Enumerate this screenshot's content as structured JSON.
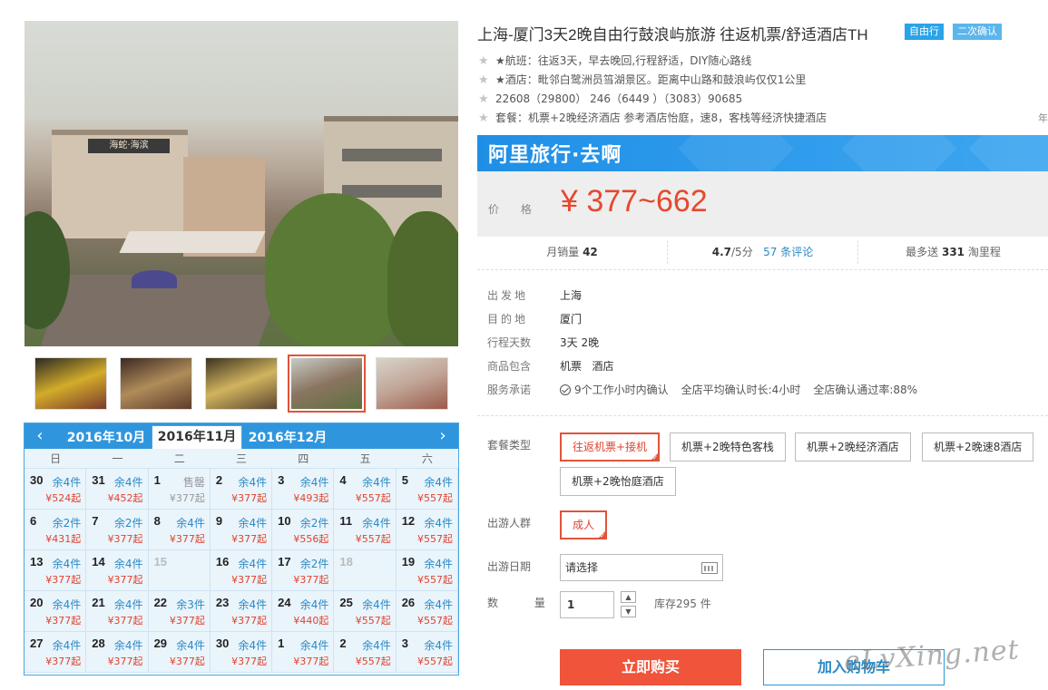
{
  "product": {
    "title": "上海-厦门3天2晚自由行鼓浪屿旅游 往返机票/舒适酒店TH",
    "tags": [
      "自由行",
      "二次确认"
    ],
    "brief": [
      "★航班：往返3天，早去晚回,行程舒适，DIY随心路线",
      "★酒店：毗邻白鹭洲员筜湖景区。距离中山路和鼓浪屿仅仅1公里",
      "22608（29800） 246（6449 ）（3083）90685",
      "套餐：机票+2晚经济酒店 参考酒店怡庭，速8，客栈等经济快捷酒店"
    ],
    "brief_more": "年"
  },
  "price_box": {
    "brand": "阿里旅行·去啊",
    "label": "价 格",
    "price": "¥ 377~662"
  },
  "stats": {
    "monthly_label": "月销量",
    "monthly_value": "42",
    "rating": "4.7",
    "rating_suffix": "/5分",
    "reviews": "57 条评论",
    "points_prefix": "最多送",
    "points_value": "331",
    "points_suffix": "淘里程"
  },
  "info": [
    {
      "key": "出发地",
      "value": "上海"
    },
    {
      "key": "目的地",
      "value": "厦门"
    },
    {
      "key": "行程天数",
      "value": "3天 2晚"
    },
    {
      "key": "商品包含",
      "value": "机票   酒店"
    }
  ],
  "promise": {
    "key": "服务承诺",
    "items": [
      "9个工作小时内确认",
      "全店平均确认时长:4小时",
      "全店确认通过率:88%"
    ]
  },
  "options": {
    "package_label": "套餐类型",
    "packages": [
      "往返机票+接机",
      "机票+2晚特色客栈",
      "机票+2晚经济酒店",
      "机票+2晚速8酒店",
      "机票+2晚怡庭酒店"
    ],
    "crowd_label": "出游人群",
    "crowd": [
      "成人"
    ],
    "date_label": "出游日期",
    "date_placeholder": "请选择",
    "qty_label": "数 量",
    "qty_value": "1",
    "stock": "库存295 件"
  },
  "actions": {
    "buy": "立即购买",
    "cart": "加入购物车"
  },
  "watermark": "eLvXing.net",
  "calendar": {
    "months": [
      "2016年10月",
      "2016年11月",
      "2016年12月"
    ],
    "active_month": 1,
    "weekdays": [
      "日",
      "一",
      "二",
      "三",
      "四",
      "五",
      "六"
    ],
    "days": [
      {
        "d": "30",
        "s": "余4件",
        "p": "¥524起"
      },
      {
        "d": "31",
        "s": "余4件",
        "p": "¥452起"
      },
      {
        "d": "1",
        "s": "售罄",
        "p": "¥377起",
        "sold": true
      },
      {
        "d": "2",
        "s": "余4件",
        "p": "¥377起"
      },
      {
        "d": "3",
        "s": "余4件",
        "p": "¥493起"
      },
      {
        "d": "4",
        "s": "余4件",
        "p": "¥557起"
      },
      {
        "d": "5",
        "s": "余4件",
        "p": "¥557起"
      },
      {
        "d": "6",
        "s": "余2件",
        "p": "¥431起"
      },
      {
        "d": "7",
        "s": "余2件",
        "p": "¥377起"
      },
      {
        "d": "8",
        "s": "余4件",
        "p": "¥377起"
      },
      {
        "d": "9",
        "s": "余4件",
        "p": "¥377起"
      },
      {
        "d": "10",
        "s": "余2件",
        "p": "¥556起"
      },
      {
        "d": "11",
        "s": "余4件",
        "p": "¥557起"
      },
      {
        "d": "12",
        "s": "余4件",
        "p": "¥557起"
      },
      {
        "d": "13",
        "s": "余4件",
        "p": "¥377起"
      },
      {
        "d": "14",
        "s": "余4件",
        "p": "¥377起"
      },
      {
        "d": "15",
        "s": "",
        "p": "",
        "disabled": true
      },
      {
        "d": "16",
        "s": "余4件",
        "p": "¥377起"
      },
      {
        "d": "17",
        "s": "余2件",
        "p": "¥377起"
      },
      {
        "d": "18",
        "s": "",
        "p": "",
        "disabled": true
      },
      {
        "d": "19",
        "s": "余4件",
        "p": "¥557起"
      },
      {
        "d": "20",
        "s": "余4件",
        "p": "¥377起"
      },
      {
        "d": "21",
        "s": "余4件",
        "p": "¥377起"
      },
      {
        "d": "22",
        "s": "余3件",
        "p": "¥377起"
      },
      {
        "d": "23",
        "s": "余4件",
        "p": "¥377起"
      },
      {
        "d": "24",
        "s": "余4件",
        "p": "¥440起"
      },
      {
        "d": "25",
        "s": "余4件",
        "p": "¥557起"
      },
      {
        "d": "26",
        "s": "余4件",
        "p": "¥557起"
      },
      {
        "d": "27",
        "s": "余4件",
        "p": "¥377起"
      },
      {
        "d": "28",
        "s": "余4件",
        "p": "¥377起"
      },
      {
        "d": "29",
        "s": "余4件",
        "p": "¥377起"
      },
      {
        "d": "30",
        "s": "余4件",
        "p": "¥377起"
      },
      {
        "d": "1",
        "s": "余4件",
        "p": "¥377起"
      },
      {
        "d": "2",
        "s": "余4件",
        "p": "¥557起"
      },
      {
        "d": "3",
        "s": "余4件",
        "p": "¥557起"
      }
    ]
  },
  "main_photo": {
    "sign": "海蛇·海滨"
  },
  "thumbs": [
    {
      "colors": [
        "#2b2a24",
        "#d3ac2a",
        "#7a3a2c"
      ]
    },
    {
      "colors": [
        "#3b2a22",
        "#b08c5a",
        "#5e3b2a"
      ]
    },
    {
      "colors": [
        "#3c3322",
        "#d1b45e",
        "#5b4631"
      ]
    },
    {
      "colors": [
        "#c6cbc6",
        "#8a7460",
        "#5e7141"
      ]
    },
    {
      "colors": [
        "#d9d4c9",
        "#c0a496",
        "#9b5a4a"
      ]
    }
  ]
}
